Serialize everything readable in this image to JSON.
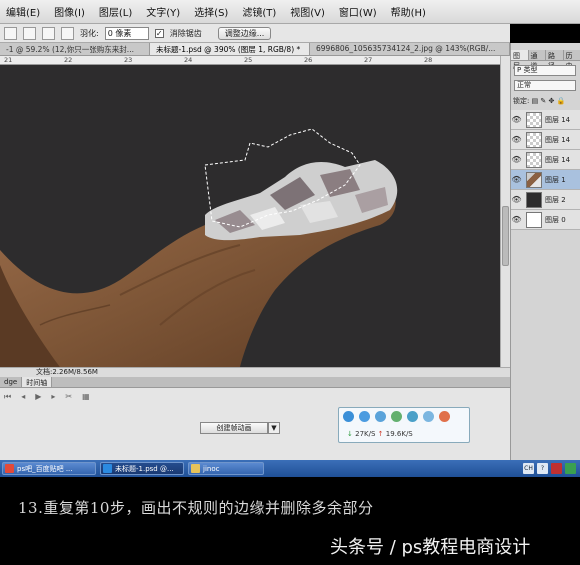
{
  "menu": [
    "编辑(E)",
    "图像(I)",
    "图层(L)",
    "文字(Y)",
    "选择(S)",
    "滤镜(T)",
    "视图(V)",
    "窗口(W)",
    "帮助(H)"
  ],
  "options": {
    "feather_label": "羽化:",
    "feather_value": "0 像素",
    "antialias_label": "消除锯齿",
    "antialias_checked": "✓",
    "refine_edge": "调整边缘..."
  },
  "tabs": [
    "-1 @ 59.2% (12,你只一张购东来封...",
    "未标题-1.psd @ 390% (图层 1, RGB/8) *",
    "6996806_105635734124_2.jpg @ 143%(RGB/..."
  ],
  "ruler_ticks": [
    "21",
    "22",
    "23",
    "24",
    "25",
    "26",
    "27",
    "28"
  ],
  "status": {
    "doc": "文档:2.26M/8.56M"
  },
  "timeline": {
    "tabs": [
      "dge",
      "时间轴"
    ],
    "create_animation": "创建帧动画",
    "dropdown": "▼"
  },
  "network": {
    "down": "27K/S",
    "up": "19.6K/S"
  },
  "panel": {
    "tabs": [
      "图层",
      "通道",
      "路径",
      "历史"
    ],
    "filter": "P 类型",
    "blend": "正常",
    "lock": "锁定:",
    "layers": [
      {
        "name": "图层 14",
        "thumb": "checker",
        "active": false
      },
      {
        "name": "图层 14",
        "thumb": "checker",
        "active": false
      },
      {
        "name": "图层 14",
        "thumb": "checker",
        "active": false
      },
      {
        "name": "图层 1",
        "thumb": "finger",
        "active": true
      },
      {
        "name": "图层 2",
        "thumb": "dark",
        "active": false
      },
      {
        "name": "图层 0",
        "thumb": "white",
        "active": false
      }
    ]
  },
  "taskbar": {
    "items": [
      "ps吧_百度贴吧 ...",
      "未标题-1.psd @...",
      "jinoc"
    ],
    "tray": [
      "CH",
      "?"
    ]
  },
  "caption": {
    "step": "13.重复第10步，画出不规则的边缘并删除多余部分",
    "watermark": "头条号 / ps教程电商设计"
  },
  "colors": {
    "canvas": "#2d2c2d",
    "skin": "#8a6042",
    "taskbar": "#2a5aa4"
  }
}
